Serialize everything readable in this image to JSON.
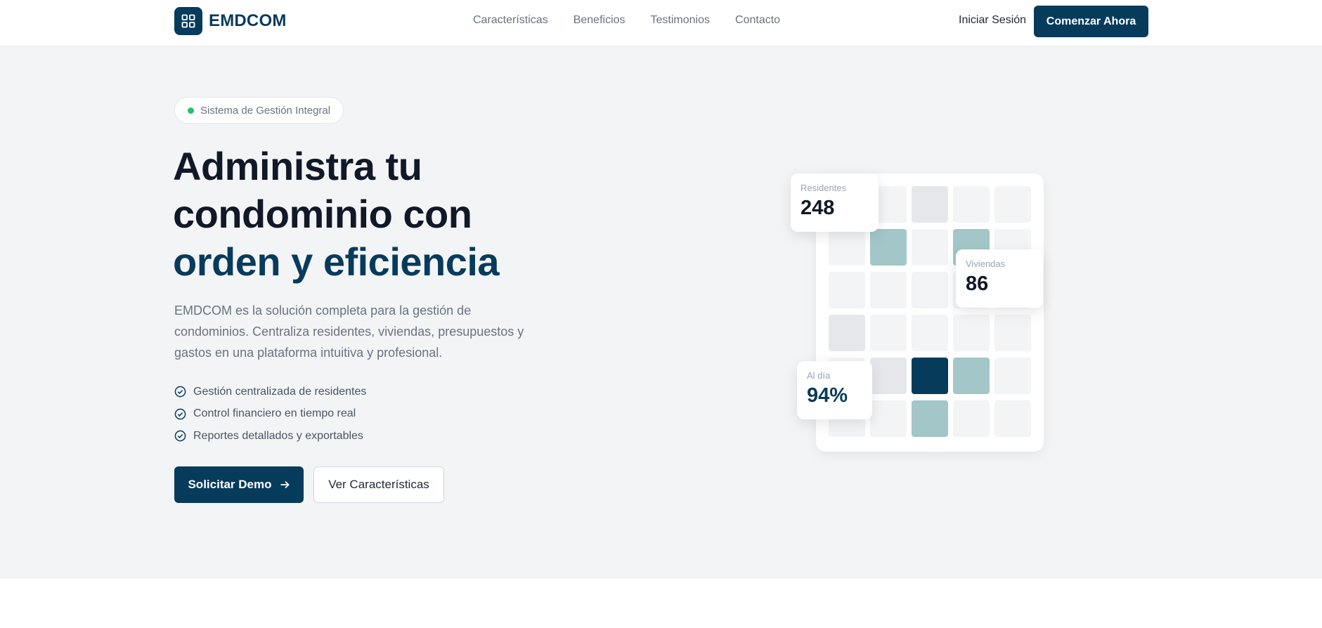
{
  "nav": {
    "brand": "EMDCOM",
    "links": [
      "Características",
      "Beneficios",
      "Testimonios",
      "Contacto"
    ],
    "login": "Iniciar Sesión",
    "cta": "Comenzar Ahora"
  },
  "hero": {
    "badge": "Sistema de Gestión Integral",
    "title_line1": "Administra tu",
    "title_line2": "condominio con",
    "title_line3": "orden y eficiencia",
    "description": "EMDCOM es la solución completa para la gestión de condominios. Centraliza residentes, viviendas, presupuestos y gastos en una plataforma intuitiva y profesional.",
    "features": [
      "Gestión centralizada de residentes",
      "Control financiero en tiempo real",
      "Reportes detallados y exportables"
    ],
    "primary_button": "Solicitar Demo",
    "secondary_button": "Ver Características"
  },
  "stats": {
    "residentes": {
      "label": "Residentes",
      "value": "248"
    },
    "viviendas": {
      "label": "Viviendas",
      "value": "86"
    },
    "al_dia": {
      "label": "Al día",
      "value": "94%"
    }
  },
  "colors": {
    "primary": "#073b5c",
    "teal": "#a3c6c8",
    "badge_dot": "#22c55e",
    "hero_bg": "#f3f4f6"
  }
}
